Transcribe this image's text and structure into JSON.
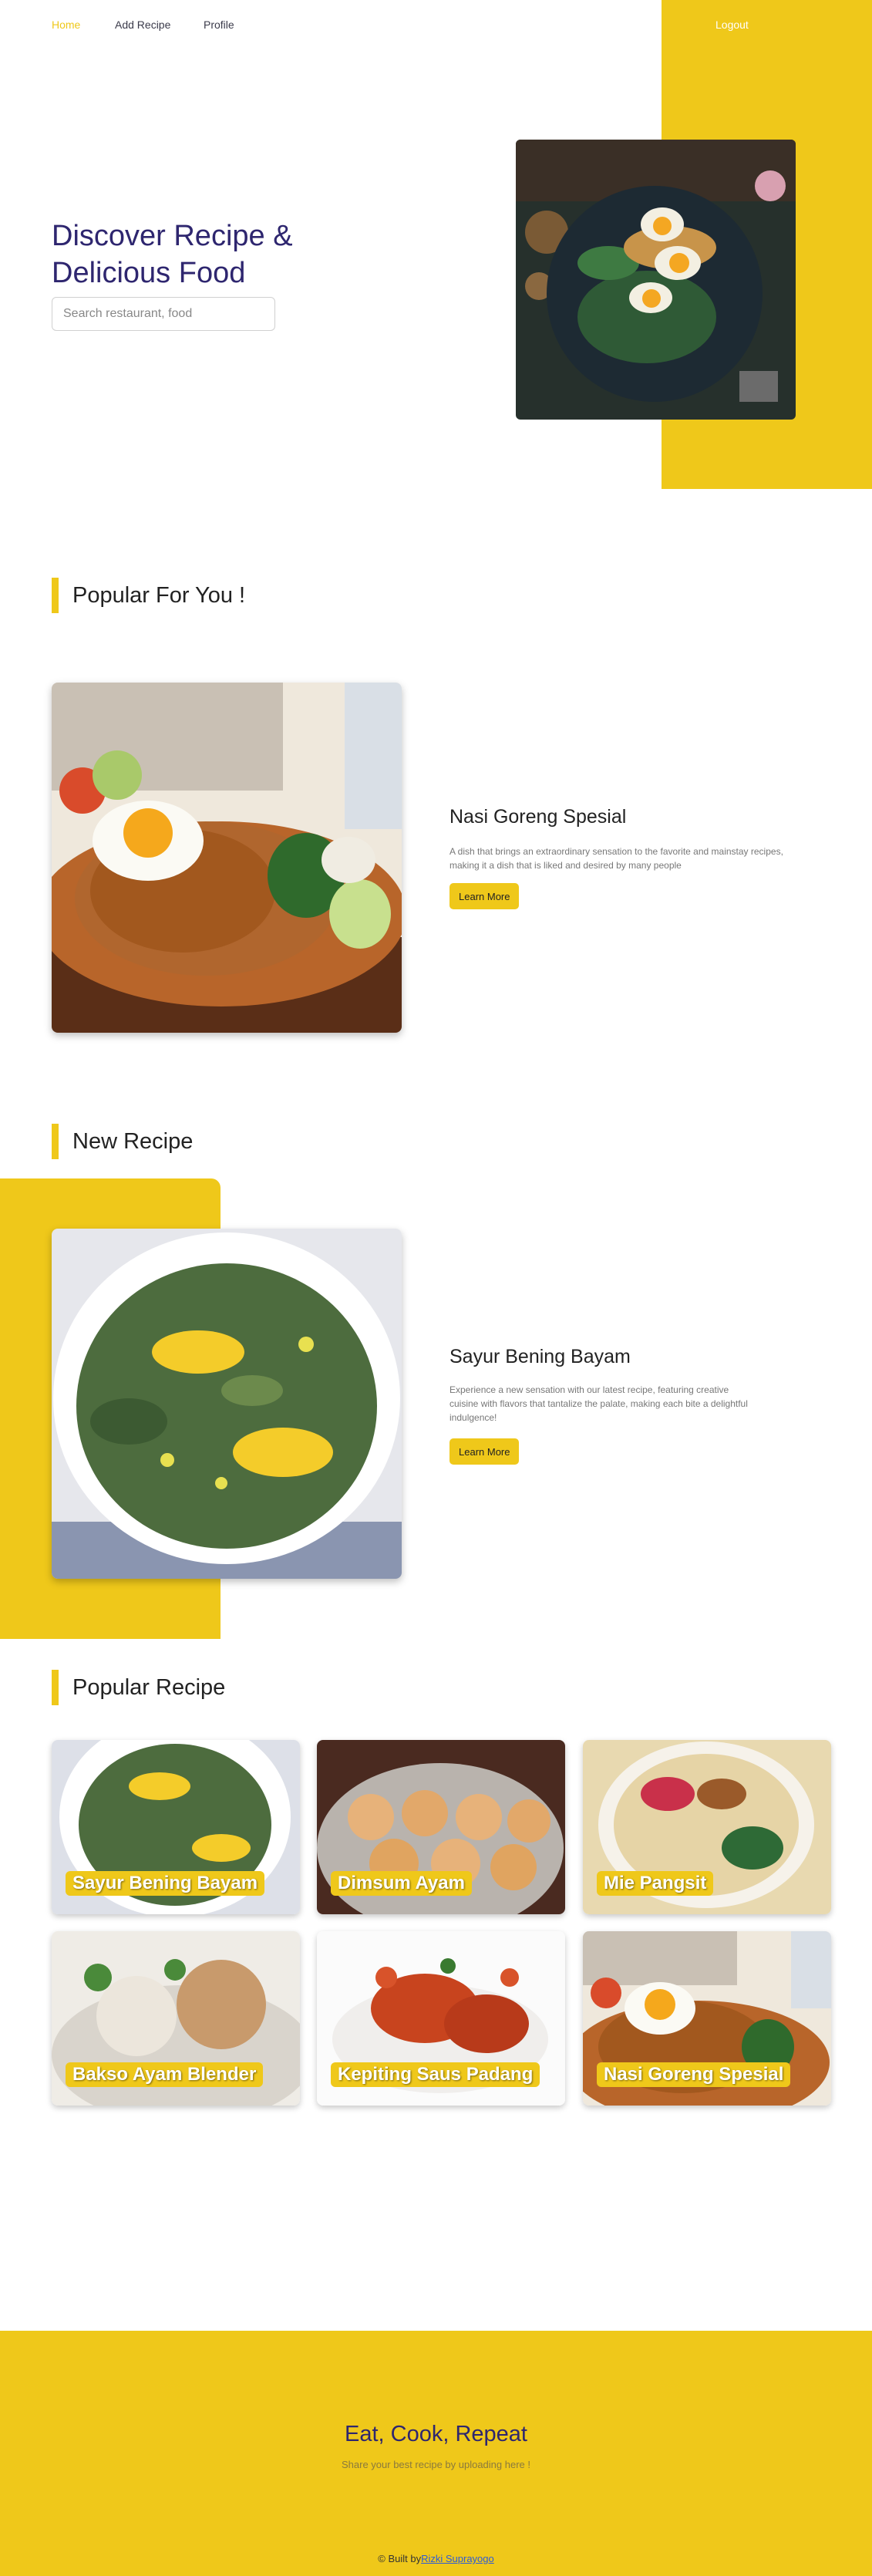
{
  "nav": {
    "home": "Home",
    "add_recipe": "Add Recipe",
    "profile": "Profile",
    "logout": "Logout"
  },
  "hero": {
    "title": "Discover Recipe & Delicious Food",
    "search_placeholder": "Search restaurant, food"
  },
  "popular_for_you": {
    "heading": "Popular For You !",
    "name": "Nasi Goreng Spesial",
    "description": "A dish that brings an extraordinary sensation to the favorite and mainstay recipes, making it a dish that is liked and desired by many people",
    "button": "Learn More"
  },
  "new_recipe": {
    "heading": "New Recipe",
    "name": "Sayur Bening Bayam",
    "description": "Experience a new sensation with our latest recipe, featuring creative cuisine with flavors that tantalize the palate, making each bite a delightful indulgence!",
    "button": "Learn More"
  },
  "popular_recipe": {
    "heading": "Popular Recipe",
    "items": [
      {
        "name": "Sayur Bening Bayam"
      },
      {
        "name": "Dimsum Ayam"
      },
      {
        "name": "Mie Pangsit"
      },
      {
        "name": "Bakso Ayam Blender"
      },
      {
        "name": "Kepiting Saus Padang"
      },
      {
        "name": "Nasi Goreng Spesial"
      }
    ]
  },
  "footer": {
    "title": "Eat, Cook, Repeat",
    "subtitle": "Share your best recipe by uploading here !",
    "credit_prefix": "© Built by",
    "credit_name": "Rizki Suprayogo"
  },
  "colors": {
    "accent": "#efc81a",
    "heading": "#2e266f"
  }
}
